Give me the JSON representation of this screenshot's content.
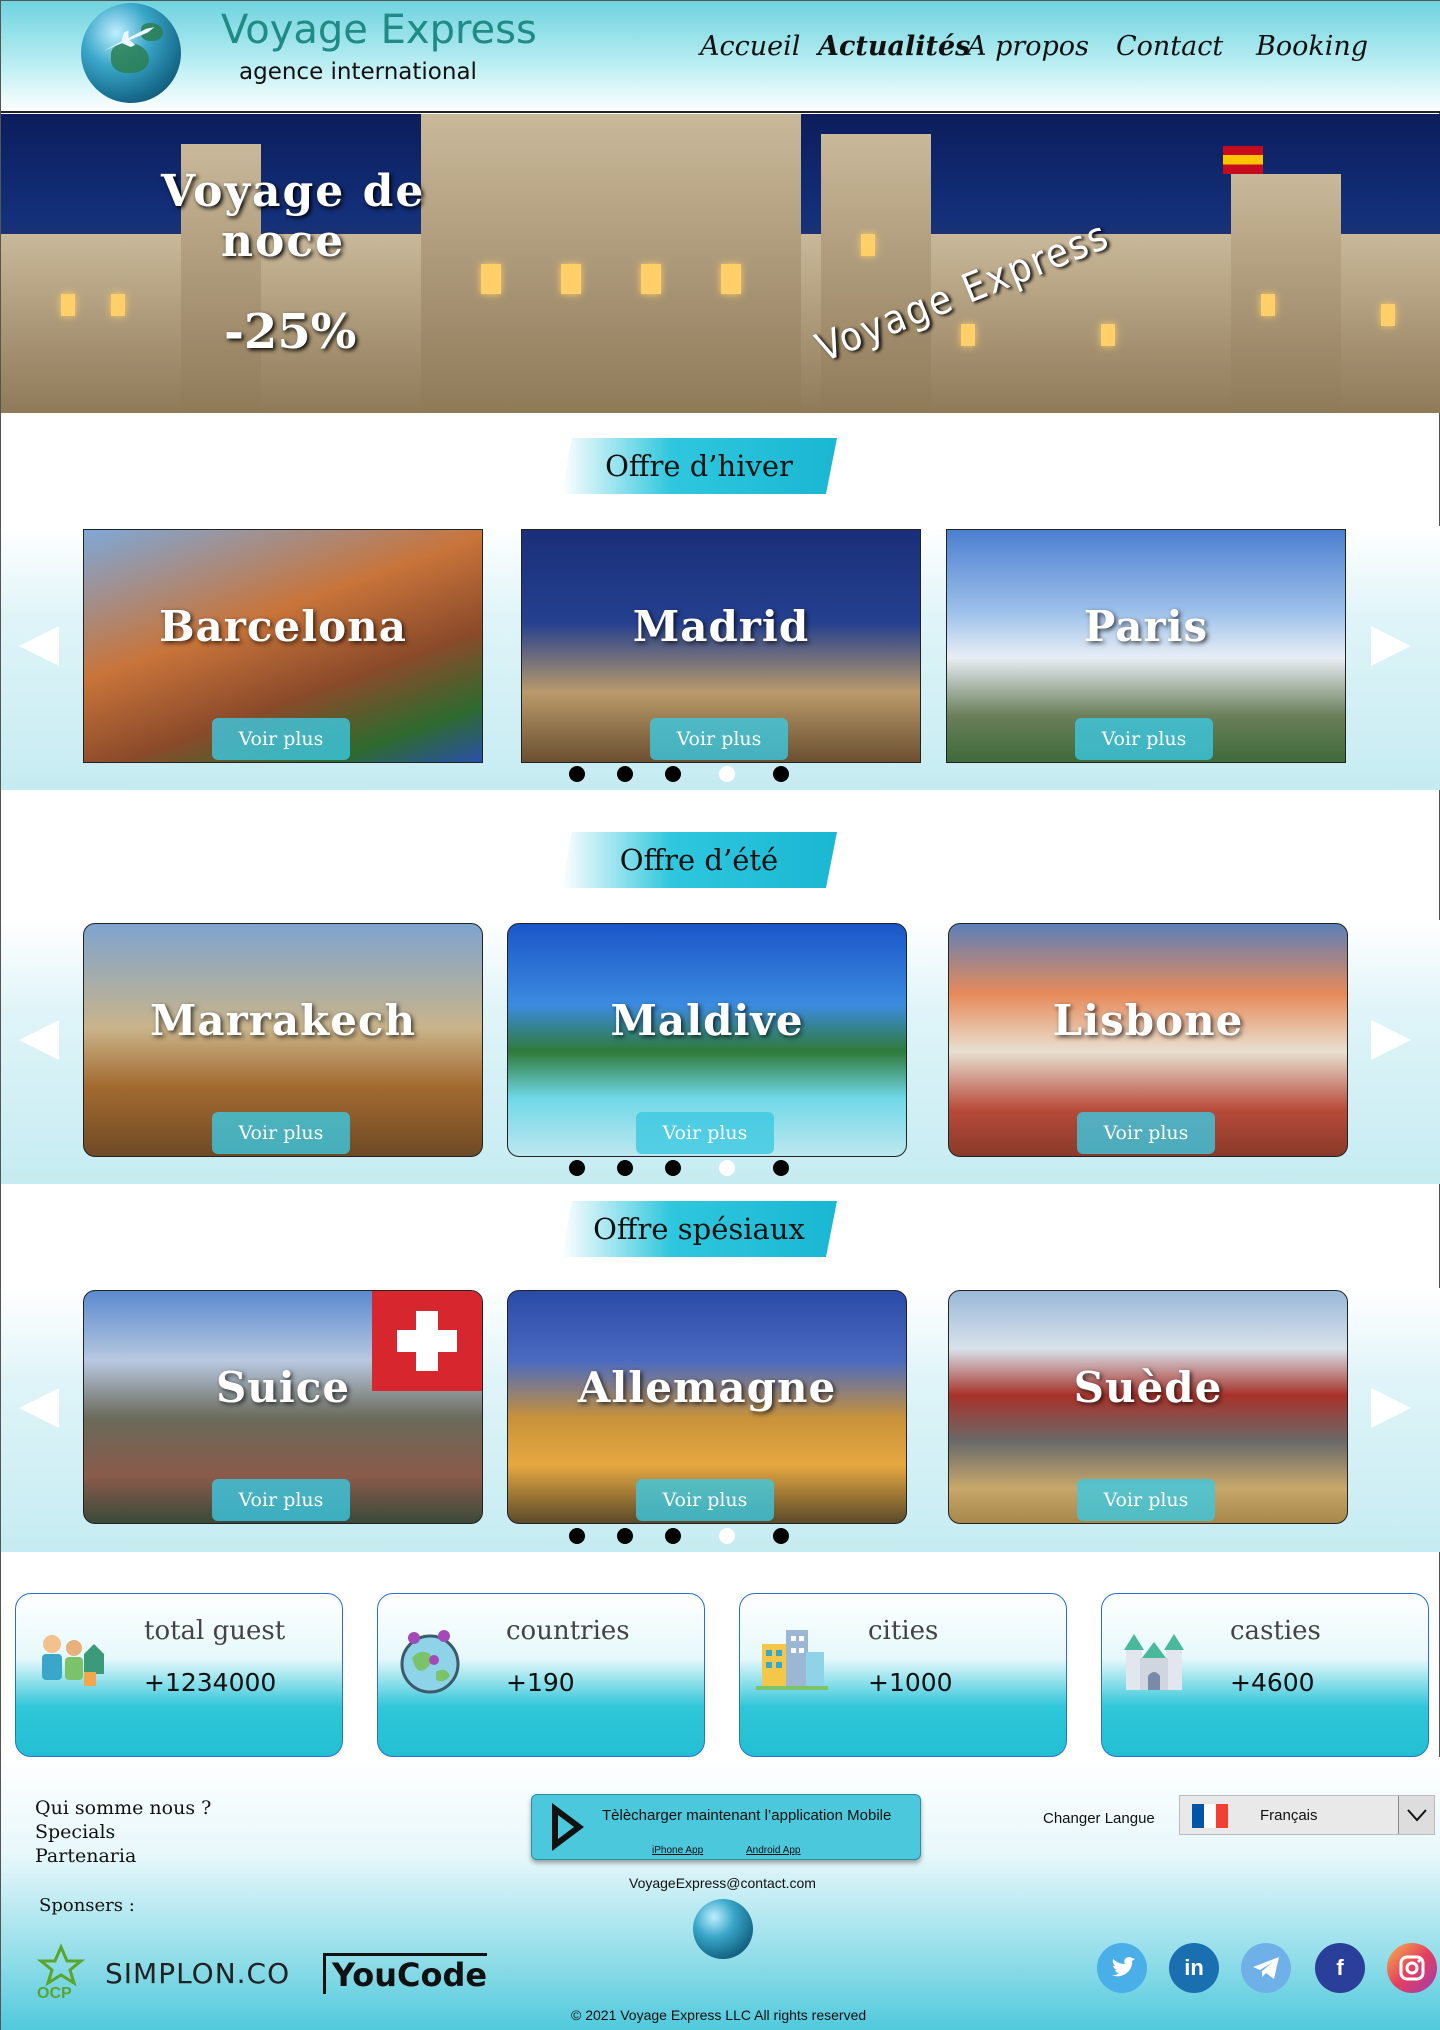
{
  "header": {
    "brand_title": "Voyage Express",
    "brand_subtitle": "agence international",
    "nav": [
      "Accueil",
      "Actualités",
      "A propos",
      "Contact",
      "Booking"
    ],
    "active_nav": "Actualités"
  },
  "hero": {
    "title_line1": "Voyage de",
    "title_line2": "noce",
    "discount": "-25%",
    "script_text": "Voyage Express"
  },
  "sections": [
    {
      "title": "Offre d’hiver",
      "cards": [
        {
          "city": "Barcelona",
          "button": "Voir plus"
        },
        {
          "city": "Madrid",
          "button": "Voir plus"
        },
        {
          "city": "Paris",
          "button": "Voir plus"
        }
      ]
    },
    {
      "title": "Offre d’été",
      "cards": [
        {
          "city": "Marrakech",
          "button": "Voir plus"
        },
        {
          "city": "Maldive",
          "button": "Voir plus"
        },
        {
          "city": "Lisbone",
          "button": "Voir plus"
        }
      ]
    },
    {
      "title": "Offre spésiaux",
      "cards": [
        {
          "city": "Suice",
          "button": "Voir plus"
        },
        {
          "city": "Allemagne",
          "button": "Voir plus"
        },
        {
          "city": "Suède",
          "button": "Voir plus"
        }
      ]
    }
  ],
  "stats": [
    {
      "label": "total guest",
      "value": "+1234000",
      "icon": "people-icon"
    },
    {
      "label": "countries",
      "value": "+190",
      "icon": "globe-pin-icon"
    },
    {
      "label": "cities",
      "value": "+1000",
      "icon": "buildings-icon"
    },
    {
      "label": "casties",
      "value": "+4600",
      "icon": "castle-icon"
    }
  ],
  "footer": {
    "links": [
      "Qui somme nous ?",
      "Specials",
      "Partenaria"
    ],
    "sponsors_label": "Sponsers :",
    "sponsors": [
      "OCP",
      "SIMPLON.CO",
      "YouCode"
    ],
    "app_text": "Tèlècharger maintenant l’application Mobile",
    "iphone_link": "iPhone App",
    "android_link": "Android App",
    "email": "VoyageExpress@contact.com",
    "lang_label": "Changer Langue",
    "lang_value": "Français",
    "copyright": "© 2021 Voyage Express LLC All rights reserved",
    "social": [
      "twitter-icon",
      "linkedin-icon",
      "telegram-icon",
      "facebook-icon",
      "instagram-icon"
    ]
  },
  "colors": {
    "accent": "#1ab7d3",
    "brand": "#1f8a86",
    "header_bg": "#6fd3df"
  }
}
